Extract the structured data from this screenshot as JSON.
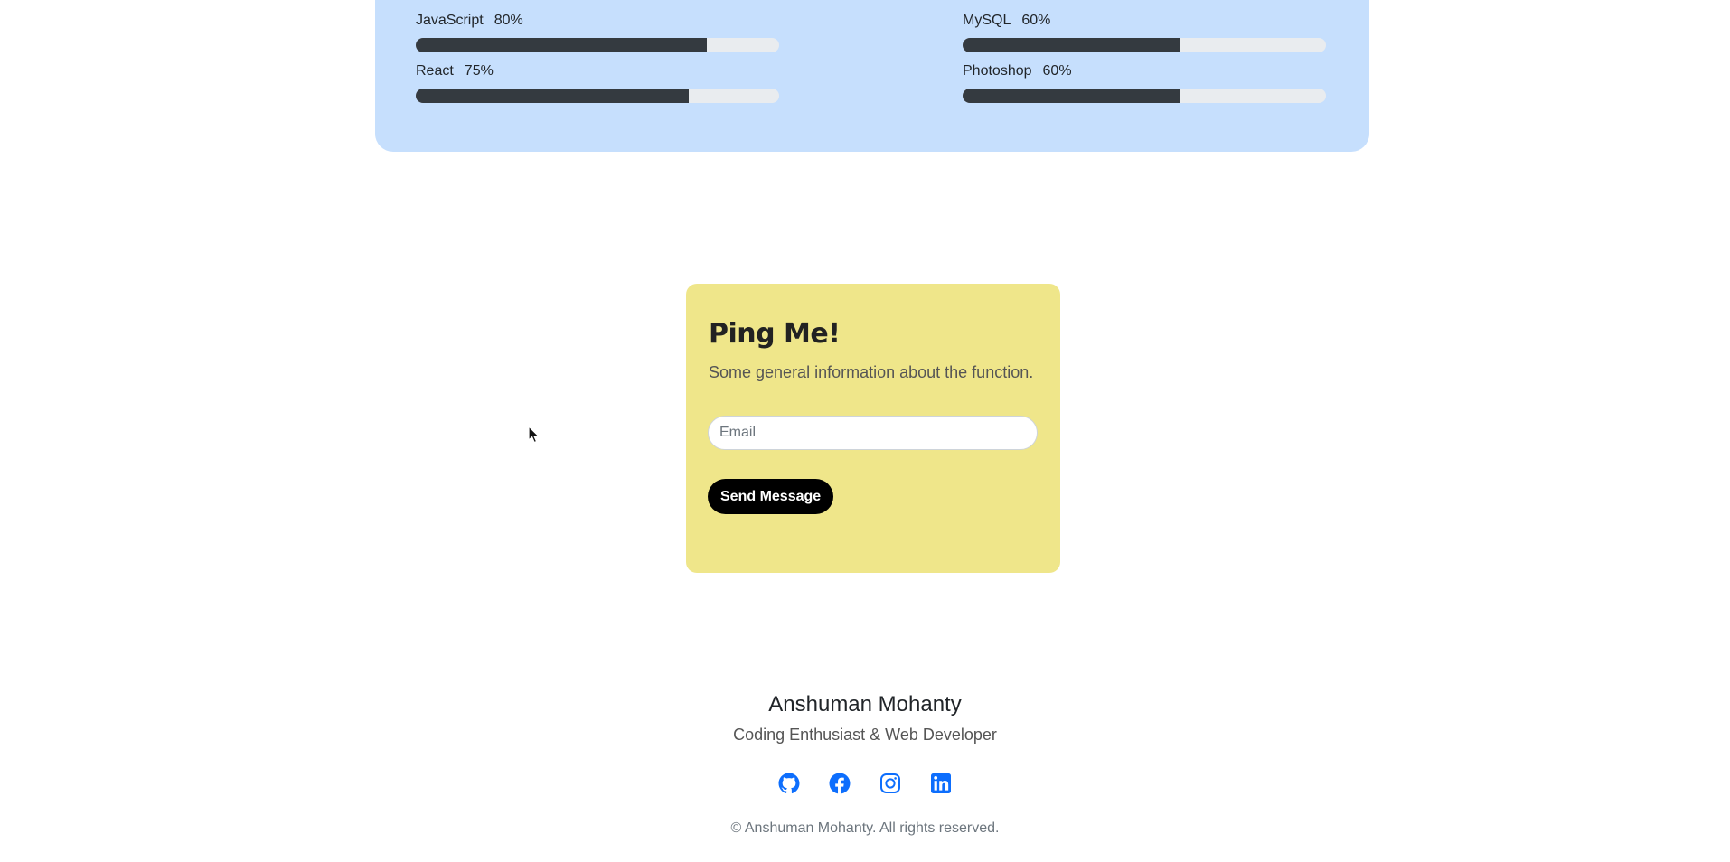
{
  "skills": [
    {
      "name": "JavaScript",
      "percent_label": "80%",
      "level": 0.8
    },
    {
      "name": "MySQL",
      "percent_label": "60%",
      "level": 0.6
    },
    {
      "name": "React",
      "percent_label": "75%",
      "level": 0.75
    },
    {
      "name": "Photoshop",
      "percent_label": "60%",
      "level": 0.6
    }
  ],
  "contact": {
    "title": "Ping Me!",
    "description": "Some general information about the function.",
    "email_placeholder": "Email",
    "email_value": "",
    "send_label": "Send Message"
  },
  "footer": {
    "name": "Anshuman Mohanty",
    "tagline": "Coding Enthusiast & Web Developer",
    "social_icons": [
      "github-icon",
      "facebook-icon",
      "instagram-icon",
      "linkedin-icon"
    ],
    "copyright": "© Anshuman Mohanty. All rights reserved."
  },
  "colors": {
    "skills_panel": "#c6dffd",
    "skill_fill": "#343a40",
    "skill_track": "#e9ecef",
    "contact_card": "#efe68a",
    "button": "#000000",
    "social_icon": "#0d6efd"
  }
}
